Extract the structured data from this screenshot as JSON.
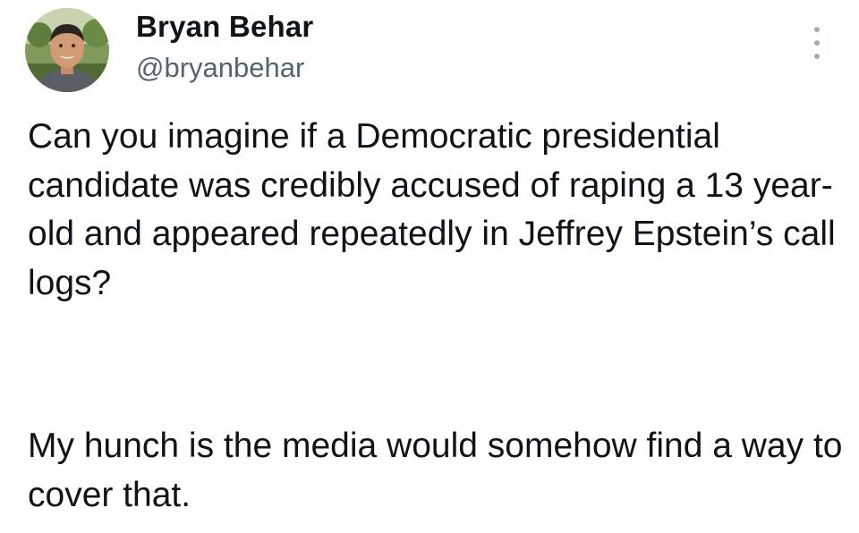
{
  "author": {
    "display_name": "Bryan Behar",
    "handle": "@bryanbehar",
    "avatar_icon": "profile-photo"
  },
  "menu": {
    "icon": "more-options-icon"
  },
  "tweet": {
    "paragraph_1": "Can you imagine if a Democratic presidential candidate was credibly accused of raping a 13 year-old and appeared repeatedly in Jeffrey Epstein’s call logs?",
    "paragraph_2": "My hunch is the media would somehow find a way to cover that."
  },
  "colors": {
    "text": "#0f1419",
    "secondary_text": "#536471",
    "background": "#ffffff"
  }
}
